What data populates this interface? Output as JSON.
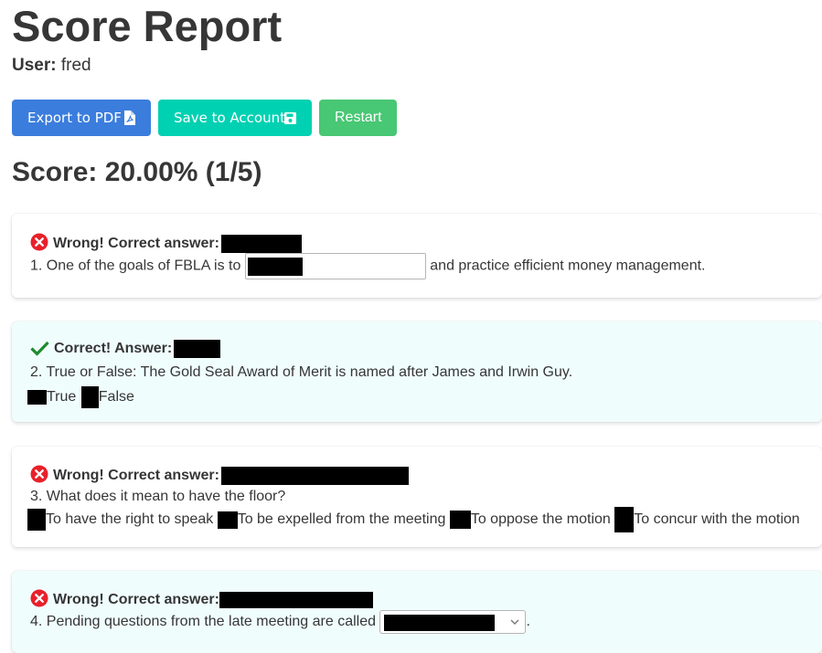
{
  "page": {
    "title": "Score Report",
    "user_label": "User:",
    "user_name": "fred"
  },
  "toolbar": {
    "export_label": "Export to PDF",
    "export_icon": "file-pdf-icon",
    "save_label": "Save to Account",
    "save_icon": "floppy-disk-icon",
    "restart_label": "Restart"
  },
  "score": {
    "text": "Score: 20.00% (1/5)"
  },
  "colors": {
    "blue": "#3b7ddd",
    "teal": "#00d1b2",
    "green": "#48c774",
    "wrong": "#e8202a",
    "correct": "#1f8a2e"
  },
  "questions": [
    {
      "status": "Wrong! Correct answer:",
      "status_icon": "x-circle-icon",
      "prompt_before": "1. One of the goals of FBLA is to",
      "prompt_after": "and practice efficient money management."
    },
    {
      "status": "Correct! Answer:",
      "status_icon": "checkmark-icon",
      "prompt": "2. True or False: The Gold Seal Award of Merit is named after James and Irwin Guy.",
      "options": [
        "True",
        "False"
      ]
    },
    {
      "status": "Wrong! Correct answer:",
      "status_icon": "x-circle-icon",
      "prompt": "3. What does it mean to have the floor?",
      "options": [
        "To have the right to speak",
        "To be expelled from the meeting",
        "To oppose the motion",
        "To concur with the motion"
      ]
    },
    {
      "status": "Wrong! Correct answer:",
      "status_icon": "x-circle-icon",
      "prompt_before": "4. Pending questions from the late meeting are called",
      "prompt_after": "."
    }
  ]
}
